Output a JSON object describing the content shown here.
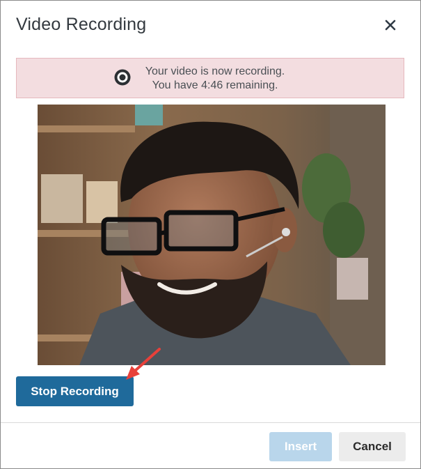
{
  "dialog": {
    "title": "Video Recording",
    "close_icon": "close-icon"
  },
  "alert": {
    "icon": "record-icon",
    "line1": "Your video is now recording.",
    "line2": "You have 4:46 remaining."
  },
  "video": {
    "description_icon": "webcam-video-feed"
  },
  "actions": {
    "stop_label": "Stop Recording",
    "insert_label": "Insert",
    "cancel_label": "Cancel"
  },
  "colors": {
    "primary": "#1f6a9b",
    "primary_disabled": "#b9d6eb",
    "alert_bg": "#f3dde0",
    "annotation_arrow": "#e8403a"
  }
}
